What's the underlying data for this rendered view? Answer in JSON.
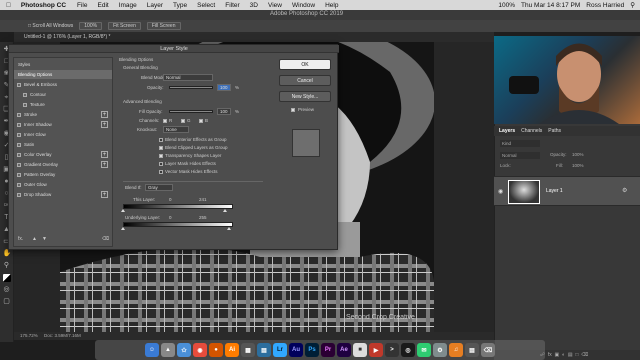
{
  "menubar": {
    "app": "Photoshop CC",
    "items": [
      "File",
      "Edit",
      "Image",
      "Layer",
      "Type",
      "Select",
      "Filter",
      "3D",
      "View",
      "Window",
      "Help"
    ],
    "battery": "100%",
    "datetime": "Thu Mar 14  8:17 PM",
    "user": "Ross Harried"
  },
  "window": {
    "title": "Adobe Photoshop CC 2019"
  },
  "options": {
    "scroll_all": "Scroll All Windows",
    "zoom": "100%",
    "fit_screen": "Fit Screen",
    "fill_screen": "Fill Screen"
  },
  "document_tab": "Untitled-1 @ 176% (Layer 1, RGB/8*) *",
  "statusbar": {
    "zoom": "175.72%",
    "doc": "Doc: 3.59M/7.16M"
  },
  "watermark": "Second Crop Creative",
  "dialog": {
    "title": "Layer Style",
    "styles_header": "Styles",
    "styles": [
      {
        "label": "Blending Options",
        "selected": true,
        "checkbox": false,
        "plus": false
      },
      {
        "label": "Bevel & Emboss",
        "checkbox": true,
        "plus": false
      },
      {
        "label": "Contour",
        "checkbox": true,
        "plus": false,
        "indent": true
      },
      {
        "label": "Texture",
        "checkbox": true,
        "plus": false,
        "indent": true
      },
      {
        "label": "Stroke",
        "checkbox": true,
        "plus": true
      },
      {
        "label": "Inner Shadow",
        "checkbox": true,
        "plus": true
      },
      {
        "label": "Inner Glow",
        "checkbox": true,
        "plus": false
      },
      {
        "label": "Satin",
        "checkbox": true,
        "plus": false
      },
      {
        "label": "Color Overlay",
        "checkbox": true,
        "plus": true
      },
      {
        "label": "Gradient Overlay",
        "checkbox": true,
        "plus": true
      },
      {
        "label": "Pattern Overlay",
        "checkbox": true,
        "plus": false
      },
      {
        "label": "Outer Glow",
        "checkbox": true,
        "plus": false
      },
      {
        "label": "Drop Shadow",
        "checkbox": true,
        "plus": true
      }
    ],
    "blending_options": "Blending Options",
    "general_blending": "General Blending",
    "blend_mode_label": "Blend Mode:",
    "blend_mode": "Normal",
    "opacity_label": "Opacity:",
    "opacity": "100",
    "percent": "%",
    "advanced_blending": "Advanced Blending",
    "fill_opacity_label": "Fill Opacity:",
    "fill_opacity": "100",
    "channels_label": "Channels:",
    "ch_r": "R",
    "ch_g": "G",
    "ch_b": "B",
    "knockout_label": "Knockout:",
    "knockout": "None",
    "checks": [
      {
        "label": "Blend Interior Effects as Group",
        "on": false
      },
      {
        "label": "Blend Clipped Layers as Group",
        "on": true
      },
      {
        "label": "Transparency Shapes Layer",
        "on": true
      },
      {
        "label": "Layer Mask Hides Effects",
        "on": false
      },
      {
        "label": "Vector Mask Hides Effects",
        "on": false
      }
    ],
    "blend_if_label": "Blend If:",
    "blend_if": "Gray",
    "this_layer_label": "This Layer:",
    "this_layer_min": "0",
    "this_layer_max": "241",
    "underlying_label": "Underlying Layer:",
    "underlying_min": "0",
    "underlying_max": "255",
    "ok": "OK",
    "cancel": "Cancel",
    "new_style": "New Style...",
    "preview": "Preview",
    "fx": "fx."
  },
  "layers": {
    "tabs": [
      "Layers",
      "Channels",
      "Paths"
    ],
    "kind": "Kind",
    "mode": "Normal",
    "opacity_label": "Opacity:",
    "opacity": "100%",
    "lock_label": "Lock:",
    "fill_label": "Fill:",
    "fill": "100%",
    "layer_name": "Layer 1"
  }
}
